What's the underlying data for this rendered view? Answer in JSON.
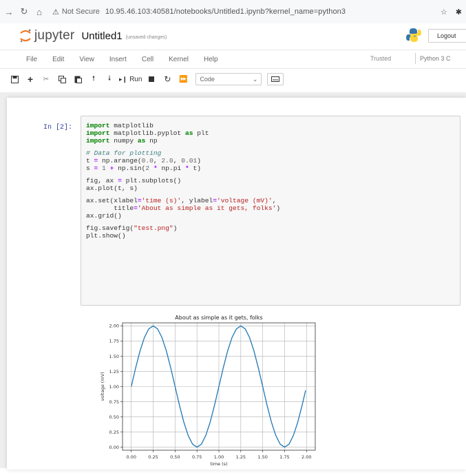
{
  "browser": {
    "not_secure": "Not Secure",
    "url": "10.95.46.103:40581/notebooks/Untitled1.ipynb?kernel_name=python3"
  },
  "header": {
    "logo_text": "jupyter",
    "notebook_title": "Untitled1",
    "save_status": "(unsaved changes)",
    "logout_label": "Logout"
  },
  "menu": {
    "items": [
      "File",
      "Edit",
      "View",
      "Insert",
      "Cell",
      "Kernel",
      "Help"
    ],
    "trusted": "Trusted",
    "kernel": "Python 3 C"
  },
  "toolbar": {
    "run_label": "Run",
    "cell_type": "Code"
  },
  "cell": {
    "prompt": "In [2]:",
    "code_lines": [
      [
        "kw:import",
        "t: matplotlib"
      ],
      [
        "kw:import",
        "t: matplotlib.pyplot ",
        "kw:as",
        "t: plt"
      ],
      [
        "kw:import",
        "t: numpy ",
        "kw:as",
        "t: np"
      ],
      [],
      [
        "cm:# Data for plotting"
      ],
      [
        "t:t ",
        "op:=",
        "t: np.arange(",
        "num:0.0",
        "t:, ",
        "num:2.0",
        "t:, ",
        "num:0.01",
        "t:)"
      ],
      [
        "t:s ",
        "op:=",
        "t: ",
        "num:1",
        "t: ",
        "op:+",
        "t: np.sin(",
        "num:2",
        "t: ",
        "op:*",
        "t: np.pi ",
        "op:*",
        "t: t)"
      ],
      [],
      [
        "t:fig, ax ",
        "op:=",
        "t: plt.subplots()"
      ],
      [
        "t:ax.plot(t, s)"
      ],
      [],
      [
        "t:ax.set(xlabel",
        "op:=",
        "str:'time (s)'",
        "t:, ylabel",
        "op:=",
        "str:'voltage (mV)'",
        "t:,"
      ],
      [
        "t:       title",
        "op:=",
        "str:'About as simple as it gets, folks'",
        "t:)"
      ],
      [
        "t:ax.grid()"
      ],
      [],
      [
        "t:fig.savefig(",
        "str:\"test.png\"",
        "t:)"
      ],
      [
        "t:plt.show()"
      ]
    ]
  },
  "chart_data": {
    "type": "line",
    "title": "About as simple as it gets, folks",
    "xlabel": "time (s)",
    "ylabel": "voltage (mV)",
    "xlim": [
      -0.1,
      2.1
    ],
    "ylim": [
      -0.05,
      2.05
    ],
    "xticks": [
      "0.00",
      "0.25",
      "0.50",
      "0.75",
      "1.00",
      "1.25",
      "1.50",
      "1.75",
      "2.00"
    ],
    "yticks": [
      "0.00",
      "0.25",
      "0.50",
      "0.75",
      "1.00",
      "1.25",
      "1.50",
      "1.75",
      "2.00"
    ],
    "grid": true,
    "line_color": "#1f77b4",
    "series": [
      {
        "x": [
          0.0,
          0.05,
          0.1,
          0.15,
          0.2,
          0.25,
          0.3,
          0.35,
          0.4,
          0.45,
          0.5,
          0.55,
          0.6,
          0.65,
          0.7,
          0.75,
          0.8,
          0.85,
          0.9,
          0.95,
          1.0,
          1.05,
          1.1,
          1.15,
          1.2,
          1.25,
          1.3,
          1.35,
          1.4,
          1.45,
          1.5,
          1.55,
          1.6,
          1.65,
          1.7,
          1.75,
          1.8,
          1.85,
          1.9,
          1.95,
          1.99
        ],
        "y": [
          1.0,
          1.309,
          1.588,
          1.809,
          1.951,
          2.0,
          1.951,
          1.809,
          1.588,
          1.309,
          1.0,
          0.691,
          0.412,
          0.191,
          0.049,
          0.0,
          0.049,
          0.191,
          0.412,
          0.691,
          1.0,
          1.309,
          1.588,
          1.809,
          1.951,
          2.0,
          1.951,
          1.809,
          1.588,
          1.309,
          1.0,
          0.691,
          0.412,
          0.191,
          0.049,
          0.0,
          0.049,
          0.191,
          0.412,
          0.691,
          0.937
        ]
      }
    ]
  }
}
